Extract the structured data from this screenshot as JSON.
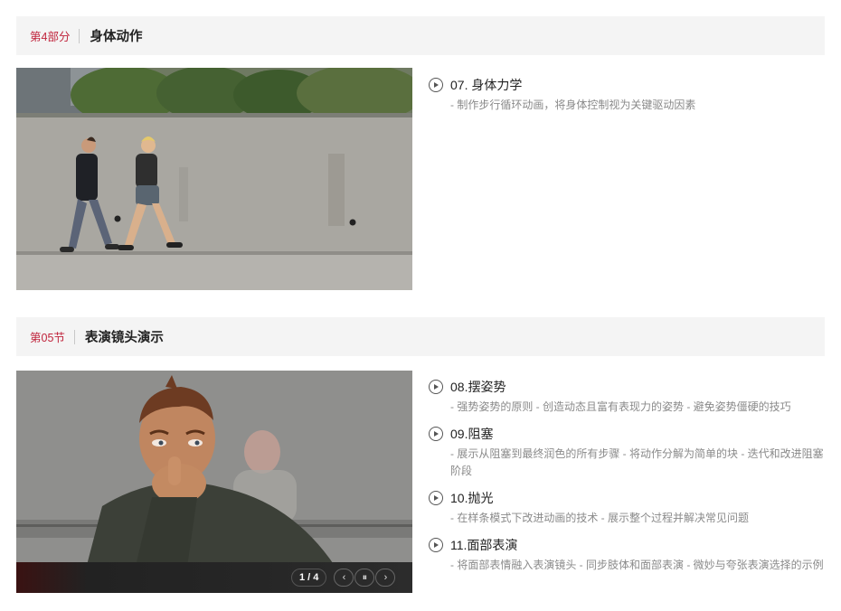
{
  "section1": {
    "number": "第4部分",
    "title": "身体动作",
    "lessons": [
      {
        "title": "07. 身体力学",
        "desc": "- 制作步行循环动画，将身体控制视为关键驱动因素"
      }
    ]
  },
  "section2": {
    "number": "第05节",
    "title": "表演镜头演示",
    "lessons": [
      {
        "title": "08.摆姿势",
        "desc": "- 强势姿势的原则 - 创造动态且富有表现力的姿势 - 避免姿势僵硬的技巧"
      },
      {
        "title": "09.阻塞",
        "desc": "- 展示从阻塞到最终润色的所有步骤 - 将动作分解为简单的块 - 迭代和改进阻塞阶段"
      },
      {
        "title": "10.抛光",
        "desc": "- 在样条模式下改进动画的技术 - 展示整个过程并解决常见问题"
      },
      {
        "title": "11.面部表演",
        "desc": "- 将面部表情融入表演镜头 - 同步肢体和面部表演 - 微妙与夸张表演选择的示例"
      }
    ],
    "player": {
      "counter": "1 / 4",
      "prev_icon": "‹",
      "pause_icon": "⏸",
      "next_icon": "›"
    }
  },
  "colors": {
    "accent": "#c0243c",
    "header_bg": "#f4f4f4"
  }
}
